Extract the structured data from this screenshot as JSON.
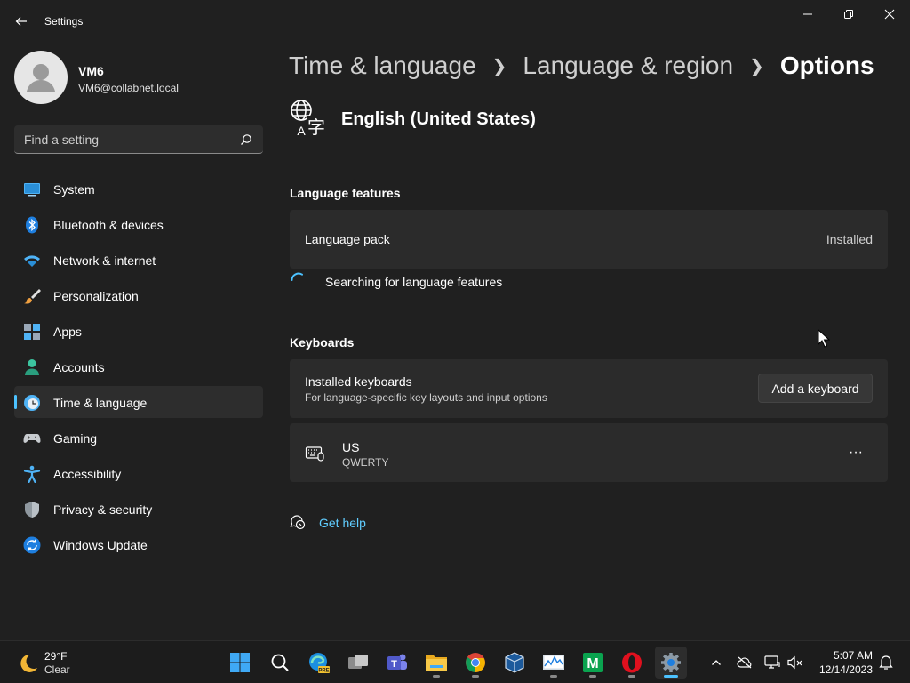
{
  "window": {
    "title": "Settings"
  },
  "user": {
    "name": "VM6",
    "email": "VM6@collabnet.local"
  },
  "search": {
    "placeholder": "Find a setting"
  },
  "sidebar": {
    "items": [
      {
        "label": "System",
        "icon": "system-icon"
      },
      {
        "label": "Bluetooth & devices",
        "icon": "bluetooth-icon"
      },
      {
        "label": "Network & internet",
        "icon": "wifi-icon"
      },
      {
        "label": "Personalization",
        "icon": "brush-icon"
      },
      {
        "label": "Apps",
        "icon": "apps-icon"
      },
      {
        "label": "Accounts",
        "icon": "accounts-icon"
      },
      {
        "label": "Time & language",
        "icon": "time-language-icon",
        "active": true
      },
      {
        "label": "Gaming",
        "icon": "gaming-icon"
      },
      {
        "label": "Accessibility",
        "icon": "accessibility-icon"
      },
      {
        "label": "Privacy & security",
        "icon": "shield-icon"
      },
      {
        "label": "Windows Update",
        "icon": "update-icon"
      }
    ]
  },
  "breadcrumb": {
    "items": [
      "Time & language",
      "Language & region",
      "Options"
    ]
  },
  "language": {
    "name": "English (United States)"
  },
  "language_features": {
    "title": "Language features",
    "pack_label": "Language pack",
    "pack_status": "Installed",
    "searching_text": "Searching for language features"
  },
  "keyboards": {
    "title": "Keyboards",
    "installed_title": "Installed keyboards",
    "installed_sub": "For language-specific key layouts and input options",
    "add_button": "Add a keyboard",
    "keyboard_name": "US",
    "keyboard_layout": "QWERTY",
    "more_label": "···"
  },
  "help": {
    "label": "Get help"
  },
  "taskbar": {
    "weather_temp": "29°F",
    "weather_cond": "Clear",
    "time": "5:07 AM",
    "date": "12/14/2023"
  },
  "colors": {
    "accent": "#4cc2ff",
    "link": "#60cdff",
    "background": "#202020",
    "card": "#2b2b2b"
  }
}
